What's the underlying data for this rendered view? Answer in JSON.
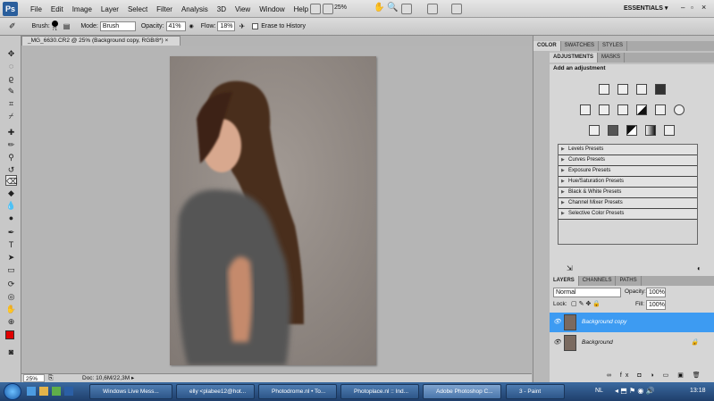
{
  "app": {
    "logo": "Ps",
    "essentials": "ESSENTIALS ▾"
  },
  "menu": [
    "File",
    "Edit",
    "Image",
    "Layer",
    "Select",
    "Filter",
    "Analysis",
    "3D",
    "View",
    "Window",
    "Help"
  ],
  "zoom_level": "25%",
  "options": {
    "brush_label": "Brush:",
    "brush_size": "71",
    "mode_label": "Mode:",
    "mode_value": "Brush",
    "opacity_label": "Opacity:",
    "opacity_value": "41%",
    "flow_label": "Flow:",
    "flow_value": "18%",
    "erase_history": "Erase to History"
  },
  "document": {
    "tab_title": "_MG_6630.CR2 @ 25% (Background copy, RGB/8*) ×",
    "status_zoom": "25%",
    "status_doc": "Doc: 10,6M/22,3M"
  },
  "top_panel_tabs": [
    "COLOR",
    "SWATCHES",
    "STYLES"
  ],
  "adjust_tabs": [
    "ADJUSTMENTS",
    "MASKS"
  ],
  "adjust_title": "Add an adjustment",
  "presets": [
    "Levels Presets",
    "Curves Presets",
    "Exposure Presets",
    "Hue/Saturation Presets",
    "Black & White Presets",
    "Channel Mixer Presets",
    "Selective Color Presets"
  ],
  "layers_panel": {
    "tabs": [
      "LAYERS",
      "CHANNELS",
      "PATHS"
    ],
    "blend_mode": "Normal",
    "opacity_label": "Opacity:",
    "opacity_value": "100%",
    "lock_label": "Lock:",
    "fill_label": "Fill:",
    "fill_value": "100%",
    "layers": [
      {
        "name": "Background copy",
        "selected": true
      },
      {
        "name": "Background",
        "selected": false
      }
    ]
  },
  "taskbar": {
    "items": [
      "Windows Live Mess...",
      "elly <plabee12@hot...",
      "Photodrome.nl • To...",
      "Photoplace.nl :: Ind...",
      "Adobe Photoshop C...",
      "3 - Paint"
    ],
    "language": "NL",
    "clock": "13:18"
  },
  "colors": {
    "selection": "#3d9bf2",
    "foreground": "#e00000",
    "background": "#000000"
  }
}
